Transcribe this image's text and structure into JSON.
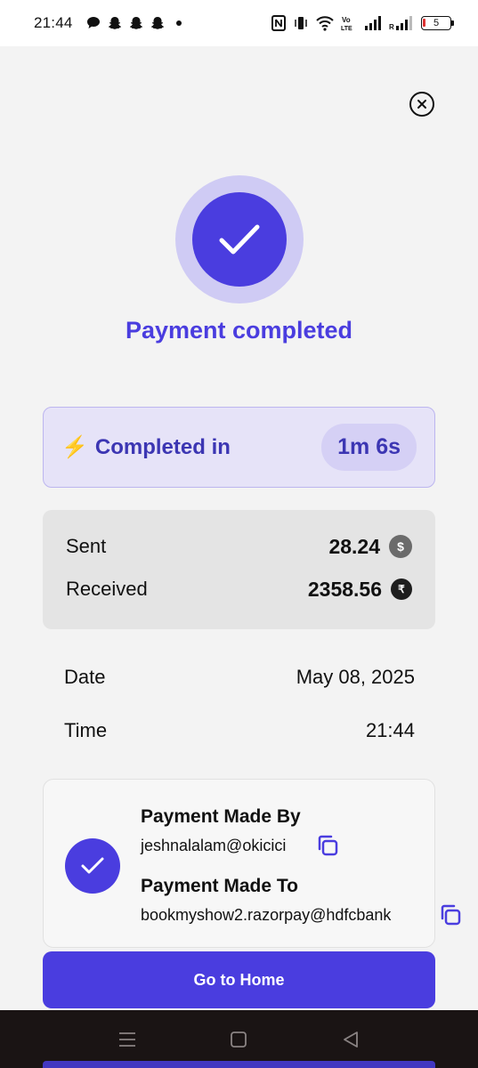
{
  "status_bar": {
    "time": "21:44",
    "battery": "5",
    "icons": [
      "chat-bubble-icon",
      "snapchat-icon",
      "snapchat-icon",
      "snapchat-icon",
      "dot-icon",
      "nfc-icon",
      "vibrate-icon",
      "wifi-icon",
      "volte-icon",
      "signal-icon",
      "signal-roaming-icon",
      "battery-icon"
    ]
  },
  "header": {
    "close_icon": "close-circle-icon"
  },
  "status": {
    "title": "Payment completed",
    "icon": "checkmark-icon",
    "accent_color": "#4a3ddf"
  },
  "completed": {
    "icon": "lightning-icon",
    "icon_glyph": "⚡",
    "label": "Completed in",
    "duration": "1m 6s"
  },
  "amounts": {
    "sent_label": "Sent",
    "sent_value": "28.24",
    "sent_currency_icon": "usdc-coin-icon",
    "sent_currency_glyph": "$",
    "received_label": "Received",
    "received_value": "2358.56",
    "received_currency_icon": "rupee-coin-icon",
    "received_currency_glyph": "₹"
  },
  "details": {
    "date_label": "Date",
    "date_value": "May 08, 2025",
    "time_label": "Time",
    "time_value": "21:44"
  },
  "payment_parties": {
    "made_by_label": "Payment Made By",
    "made_by_value": "jeshnalalam@okicici",
    "made_to_label": "Payment Made To",
    "made_to_value": "bookmyshow2.razorpay@hdfcbank"
  },
  "actions": {
    "home_label": "Go to Home"
  },
  "nav": {
    "items": [
      "menu-icon",
      "home-square-icon",
      "back-triangle-icon"
    ]
  }
}
